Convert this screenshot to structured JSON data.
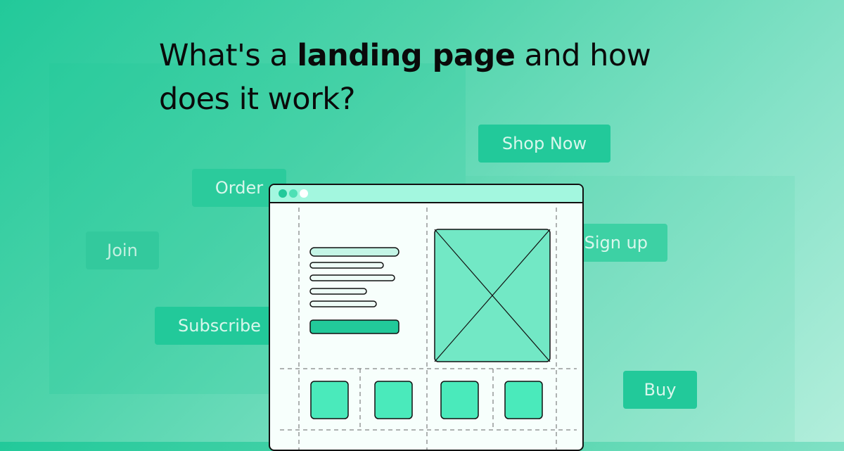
{
  "headline": {
    "part1": "What's a ",
    "bold": "landing page",
    "part2": " and how does it work?"
  },
  "ctas": {
    "order": "Order",
    "join": "Join",
    "subscribe": "Subscribe",
    "shop_now": "Shop Now",
    "sign_up": "Sign up",
    "buy": "Buy"
  },
  "colors": {
    "accent": "#22c99a",
    "browser_bar": "#a3f7df",
    "image_placeholder": "#72e8c5",
    "thumb": "#4aeabb",
    "dots": [
      "#22c99a",
      "#4ee0b5",
      "#ffffff"
    ]
  },
  "wireframe": {
    "text_lines": 5,
    "thumbnails": 4
  }
}
